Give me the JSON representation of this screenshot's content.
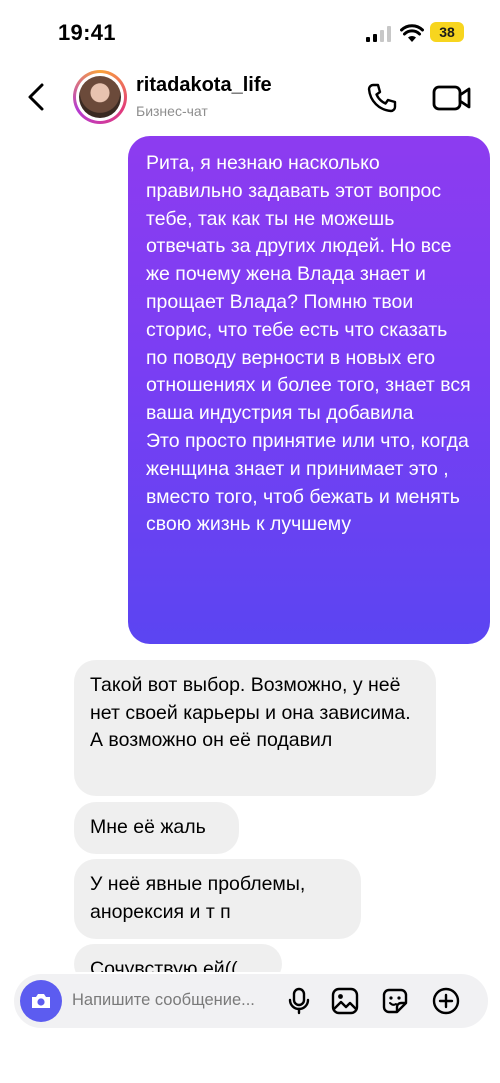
{
  "status_bar": {
    "time": "19:41",
    "battery": "38"
  },
  "header": {
    "username": "ritadakota_life",
    "subtitle": "Бизнес-чат"
  },
  "messages": {
    "outgoing": {
      "paragraph1": "Рита, я незнаю насколько правильно задавать этот вопрос тебе, так как ты не можешь отвечать за других людей. Но все же почему жена Влада знает и прощает Влада?  Помню твои сторис, что тебе есть что сказать по поводу верности в новых его отношениях и более того, знает вся ваша индустрия ты добавила",
      "paragraph2": "Это просто принятие или что, когда женщина знает и принимает это , вместо того, чтоб бежать и менять свою жизнь к лучшему"
    },
    "incoming": [
      "Такой вот выбор. Возможно, у неё нет своей карьеры и она зависима. А возможно он её подавил",
      "Мне её жаль",
      "У неё явные проблемы, анорексия и т п",
      "Сочувствую ей(("
    ]
  },
  "composer": {
    "placeholder": "Напишите сообщение..."
  },
  "colors": {
    "outgoing_top": "#8d3cf0",
    "outgoing_bottom": "#5b45f2",
    "camera_button": "#5c5cf0",
    "incoming_bg": "#efefef"
  },
  "icons": [
    "signal-icon",
    "wifi-icon",
    "back-chevron-icon",
    "phone-icon",
    "video-icon",
    "camera-icon",
    "microphone-icon",
    "gallery-icon",
    "sticker-icon",
    "plus-icon"
  ]
}
